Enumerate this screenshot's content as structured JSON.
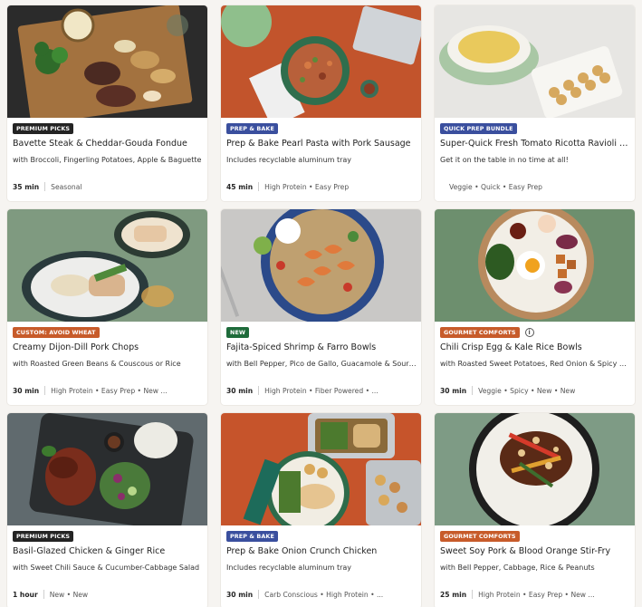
{
  "colors": {
    "premium": "#242424",
    "prep_bake": "#3a4f9e",
    "quick_prep": "#3a4f9e",
    "custom": "#c75b2a",
    "new": "#1e6b3a",
    "gourmet": "#c75b2a"
  },
  "recipes": [
    {
      "badge": "PREMIUM PICKS",
      "badge_color": "#242424",
      "title": "Bavette Steak & Cheddar-Gouda Fondue",
      "subtitle": "with Broccoli, Fingerling Potatoes, Apple & Baguette",
      "time": "35 min",
      "tags": "Seasonal",
      "info_icon": false
    },
    {
      "badge": "PREP & BAKE",
      "badge_color": "#3a4f9e",
      "title": "Prep & Bake Pearl Pasta with Pork Sausage",
      "subtitle": "Includes recyclable aluminum tray",
      "time": "45 min",
      "tags": "High Protein • Easy Prep",
      "info_icon": false
    },
    {
      "badge": "QUICK PREP BUNDLE",
      "badge_color": "#3a4f9e",
      "title": "Super-Quick Fresh Tomato Ricotta Ravioli w...",
      "subtitle": "Get it on the table in no time at all!",
      "time": "",
      "tags": "Veggie • Quick • Easy Prep",
      "info_icon": false
    },
    {
      "badge": "CUSTOM: AVOID WHEAT",
      "badge_color": "#c75b2a",
      "title": "Creamy Dijon-Dill Pork Chops",
      "subtitle": "with Roasted Green Beans & Couscous or Rice",
      "time": "30 min",
      "tags": "High Protein • Easy Prep • New ...",
      "info_icon": false
    },
    {
      "badge": "NEW",
      "badge_color": "#1e6b3a",
      "title": "Fajita-Spiced Shrimp & Farro Bowls",
      "subtitle": "with Bell Pepper, Pico de Gallo, Guacamole & Sour ...",
      "time": "30 min",
      "tags": "High Protein • Fiber Powered • ...",
      "info_icon": false
    },
    {
      "badge": "GOURMET COMFORTS",
      "badge_color": "#c75b2a",
      "title": "Chili Crisp Egg & Kale Rice Bowls",
      "subtitle": "with Roasted Sweet Potatoes, Red Onion & Spicy Ma...",
      "time": "30 min",
      "tags": "Veggie • Spicy • New • New",
      "info_icon": true
    },
    {
      "badge": "PREMIUM PICKS",
      "badge_color": "#242424",
      "title": "Basil-Glazed Chicken & Ginger Rice",
      "subtitle": "with Sweet Chili Sauce & Cucumber-Cabbage Salad",
      "time": "1 hour",
      "tags": "New • New",
      "info_icon": false
    },
    {
      "badge": "PREP & BAKE",
      "badge_color": "#3a4f9e",
      "title": "Prep & Bake Onion Crunch Chicken",
      "subtitle": "Includes recyclable aluminum tray",
      "time": "30 min",
      "tags": "Carb Conscious • High Protein • ...",
      "info_icon": false
    },
    {
      "badge": "GOURMET COMFORTS",
      "badge_color": "#c75b2a",
      "title": "Sweet Soy Pork & Blood Orange Stir-Fry",
      "subtitle": "with Bell Pepper, Cabbage, Rice & Peanuts",
      "time": "25 min",
      "tags": "High Protein • Easy Prep • New ...",
      "info_icon": false
    }
  ]
}
